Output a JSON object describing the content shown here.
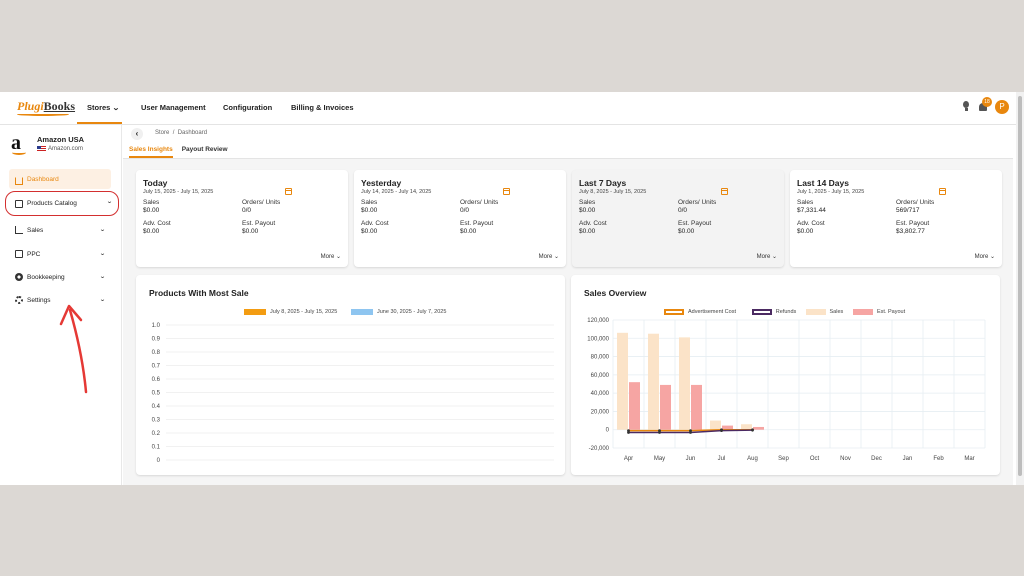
{
  "brand": {
    "logo_part1": "Plugi",
    "logo_part2": "Books"
  },
  "nav": {
    "stores": "Stores",
    "user_management": "User Management",
    "configuration": "Configuration",
    "billing": "Billing & Invoices"
  },
  "header": {
    "notification_count": "18",
    "avatar_letter": "P"
  },
  "store": {
    "name": "Amazon USA",
    "domain": "Amazon.com"
  },
  "sidebar": {
    "items": [
      {
        "label": "Dashboard"
      },
      {
        "label": "Products Catalog"
      },
      {
        "label": "Sales"
      },
      {
        "label": "PPC"
      },
      {
        "label": "Bookkeeping"
      },
      {
        "label": "Settings"
      }
    ]
  },
  "breadcrumb": {
    "store": "Store",
    "sep": "/",
    "page": "Dashboard"
  },
  "tabs": [
    {
      "label": "Sales Insights"
    },
    {
      "label": "Payout Review"
    }
  ],
  "cards": [
    {
      "title": "Today",
      "date": "July 15, 2025 - July 15, 2025",
      "sales_label": "Sales",
      "sales": "$0.00",
      "orders_label": "Orders/ Units",
      "orders": "0/0",
      "adv_label": "Adv. Cost",
      "adv": "$0.00",
      "payout_label": "Est. Payout",
      "payout": "$0.00",
      "more": "More"
    },
    {
      "title": "Yesterday",
      "date": "July 14, 2025 - July 14, 2025",
      "sales_label": "Sales",
      "sales": "$0.00",
      "orders_label": "Orders/ Units",
      "orders": "0/0",
      "adv_label": "Adv. Cost",
      "adv": "$0.00",
      "payout_label": "Est. Payout",
      "payout": "$0.00",
      "more": "More"
    },
    {
      "title": "Last 7 Days",
      "date": "July 8, 2025 - July 15, 2025",
      "sales_label": "Sales",
      "sales": "$0.00",
      "orders_label": "Orders/ Units",
      "orders": "0/0",
      "adv_label": "Adv. Cost",
      "adv": "$0.00",
      "payout_label": "Est. Payout",
      "payout": "$0.00",
      "more": "More"
    },
    {
      "title": "Last 14 Days",
      "date": "July 1, 2025 - July 15, 2025",
      "sales_label": "Sales",
      "sales": "$7,331.44",
      "orders_label": "Orders/ Units",
      "orders": "569/717",
      "adv_label": "Adv. Cost",
      "adv": "$0.00",
      "payout_label": "Est. Payout",
      "payout": "$3,802.77",
      "more": "More"
    }
  ],
  "products_panel": {
    "title": "Products With Most Sale",
    "legend": [
      {
        "label": "July 8, 2025 - July 15, 2025",
        "color": "#f39c12"
      },
      {
        "label": "June 30, 2025 - July 7, 2025",
        "color": "#8ec5f0"
      }
    ],
    "y_ticks": [
      "1.0",
      "0.9",
      "0.8",
      "0.7",
      "0.6",
      "0.5",
      "0.4",
      "0.3",
      "0.2",
      "0.1",
      "0"
    ]
  },
  "overview_panel": {
    "title": "Sales Overview"
  },
  "chart_data": {
    "type": "bar",
    "categories": [
      "Apr",
      "May",
      "Jun",
      "Jul",
      "Aug",
      "Sep",
      "Oct",
      "Nov",
      "Dec",
      "Jan",
      "Feb",
      "Mar"
    ],
    "y_ticks": [
      "120,000",
      "100,000",
      "80,000",
      "60,000",
      "40,000",
      "20,000",
      "0",
      "-20,000"
    ],
    "ylim": [
      -20000,
      120000
    ],
    "series": [
      {
        "name": "Sales",
        "type": "bar",
        "color": "#fbe3c8",
        "values": [
          106000,
          105000,
          101000,
          10000,
          6000,
          0,
          0,
          0,
          0,
          0,
          0,
          0
        ]
      },
      {
        "name": "Est. Payout",
        "type": "bar",
        "color": "#f6a5a3",
        "values": [
          52000,
          49000,
          49000,
          4500,
          3000,
          0,
          0,
          0,
          0,
          0,
          0,
          0
        ]
      },
      {
        "name": "Advertisement Cost",
        "type": "line",
        "color": "#e8870e",
        "values": [
          -1000,
          -1000,
          -1000,
          0,
          0
        ]
      },
      {
        "name": "Refunds",
        "type": "line",
        "color": "#4b2a62",
        "values": [
          -3000,
          -3000,
          -3000,
          -1000,
          -500
        ]
      }
    ],
    "grid": true,
    "legend": "top-center"
  }
}
